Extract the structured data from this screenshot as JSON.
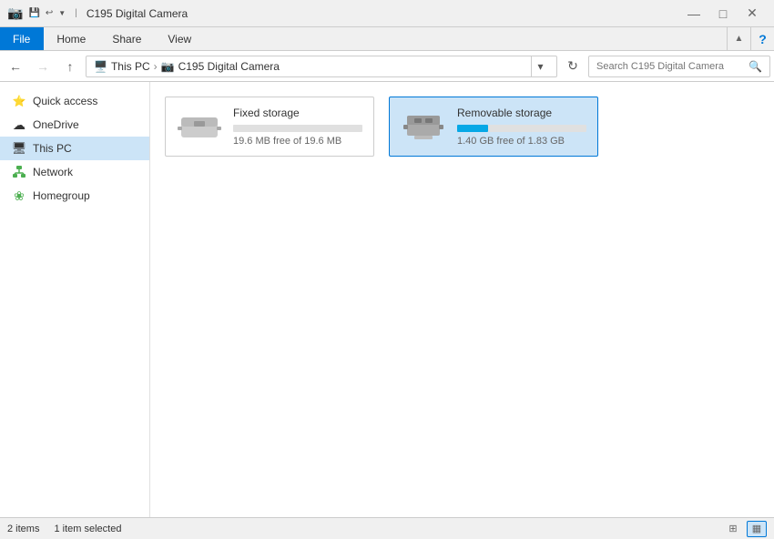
{
  "titlebar": {
    "title": "C195 Digital Camera",
    "icon": "📷",
    "minimize": "—",
    "maximize": "□",
    "close": "✕"
  },
  "ribbon": {
    "tabs": [
      "File",
      "Home",
      "Share",
      "View"
    ],
    "help": "?"
  },
  "addressbar": {
    "back_tooltip": "Back",
    "forward_tooltip": "Forward",
    "up_tooltip": "Up",
    "path": [
      {
        "label": "This PC"
      },
      {
        "label": "C195 Digital Camera"
      }
    ],
    "path_icon": "📷",
    "search_placeholder": "Search C195 Digital Camera",
    "refresh_tooltip": "Refresh"
  },
  "sidebar": {
    "items": [
      {
        "id": "quick-access",
        "label": "Quick access",
        "icon": "star"
      },
      {
        "id": "onedrive",
        "label": "OneDrive",
        "icon": "cloud"
      },
      {
        "id": "this-pc",
        "label": "This PC",
        "icon": "monitor"
      },
      {
        "id": "network",
        "label": "Network",
        "icon": "network"
      },
      {
        "id": "homegroup",
        "label": "Homegroup",
        "icon": "homegroup"
      }
    ]
  },
  "content": {
    "drives": [
      {
        "id": "fixed",
        "name": "Fixed storage",
        "type": "fixed",
        "bar_pct": 0,
        "bar_color": "#ccc",
        "free": "19.6 MB free of 19.6 MB",
        "selected": false
      },
      {
        "id": "removable",
        "name": "Removable storage",
        "type": "removable",
        "bar_pct": 24,
        "bar_color": "#06a8e6",
        "free": "1.40 GB free of 1.83 GB",
        "selected": true
      }
    ]
  },
  "statusbar": {
    "item_count": "2 items",
    "selection": "1 item selected"
  }
}
